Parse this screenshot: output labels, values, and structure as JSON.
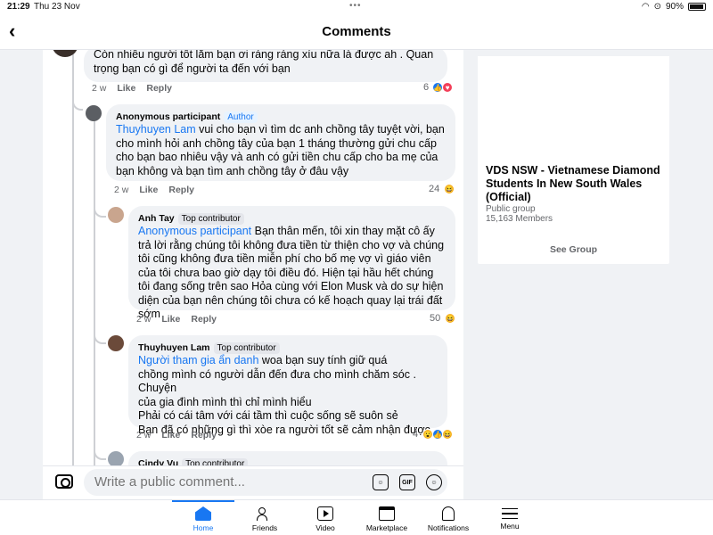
{
  "status": {
    "time": "21:29",
    "date": "Thu 23 Nov",
    "battery": "90%"
  },
  "header": {
    "title": "Comments"
  },
  "comments": [
    {
      "text": "Còn nhiều người tốt lắm bạn ơi ráng ráng xíu nữa là được ah . Quan trọng bạn có gì để người ta đến với bạn",
      "age": "2 w",
      "like": "Like",
      "reply": "Reply",
      "react_count": "6"
    },
    {
      "name": "Anonymous participant",
      "badge": "Author",
      "mention": "Thuyhuyen Lam",
      "text": " vui cho bạn vì tìm dc anh chồng tây tuyệt vời, bạn cho mình hỏi anh chồng tây của bạn 1 tháng thường gửi chu cấp cho bạn bao nhiêu vậy và anh có gửi tiền chu cấp cho ba mẹ của bạn không và bạn tìm anh chồng tây ở đâu vậy",
      "age": "2 w",
      "like": "Like",
      "reply": "Reply",
      "react_count": "24"
    },
    {
      "name": "Anh Tay",
      "badge": "Top contributor",
      "mention": "Anonymous participant",
      "text": " Bạn thân mến, tôi xin thay mặt cô ấy trả lời rằng chúng tôi không đưa tiền từ thiện cho vợ và chúng tôi cũng không đưa tiền miễn phí cho bố mẹ vợ vì giáo viên của tôi chưa bao giờ dạy tôi điều đó. Hiện tại hầu hết chúng tôi đang sống trên sao Hỏa cùng với Elon Musk và do sự hiện diện của bạn nên chúng tôi chưa có kế hoạch quay lại trái đất sớm",
      "age": "2 w",
      "like": "Like",
      "reply": "Reply",
      "react_count": "50"
    },
    {
      "name": "Thuyhuyen Lam",
      "badge": "Top contributor",
      "mention": "Người tham gia ẩn danh",
      "line1": " woa bạn suy tính giữ quá",
      "line2": "chồng mình có người dẫn đến đưa cho mình chăm sóc . Chuyện",
      "line3": "của gia đình mình thì chỉ mình hiểu",
      "line4": "Phải có cái tâm với cái tầm thì cuộc sống sẽ suôn sẻ",
      "line5": " Bạn đã có những gì thì xòe ra người tốt sẽ cảm nhận được",
      "age": "2 w",
      "like": "Like",
      "reply": "Reply",
      "react_count": "4"
    },
    {
      "name": "Cindy Vu",
      "badge": "Top contributor"
    }
  ],
  "composer": {
    "placeholder": "Write a public comment...",
    "gif_label": "GIF"
  },
  "group_card": {
    "name": "VDS NSW - Vietnamese Diamond Students In New South Wales (Official)",
    "type": "Public group",
    "members": "15,163 Members",
    "button": "See Group"
  },
  "tabs": [
    {
      "label": "Home",
      "icon": "home-icon",
      "active": true
    },
    {
      "label": "Friends",
      "icon": "friends-icon"
    },
    {
      "label": "Video",
      "icon": "video-icon"
    },
    {
      "label": "Marketplace",
      "icon": "marketplace-icon"
    },
    {
      "label": "Notifications",
      "icon": "bell-icon"
    },
    {
      "label": "Menu",
      "icon": "menu-icon"
    }
  ],
  "colors": {
    "accent": "#1877f2",
    "bubble": "#f0f2f5",
    "background": "#f0f2f5"
  }
}
